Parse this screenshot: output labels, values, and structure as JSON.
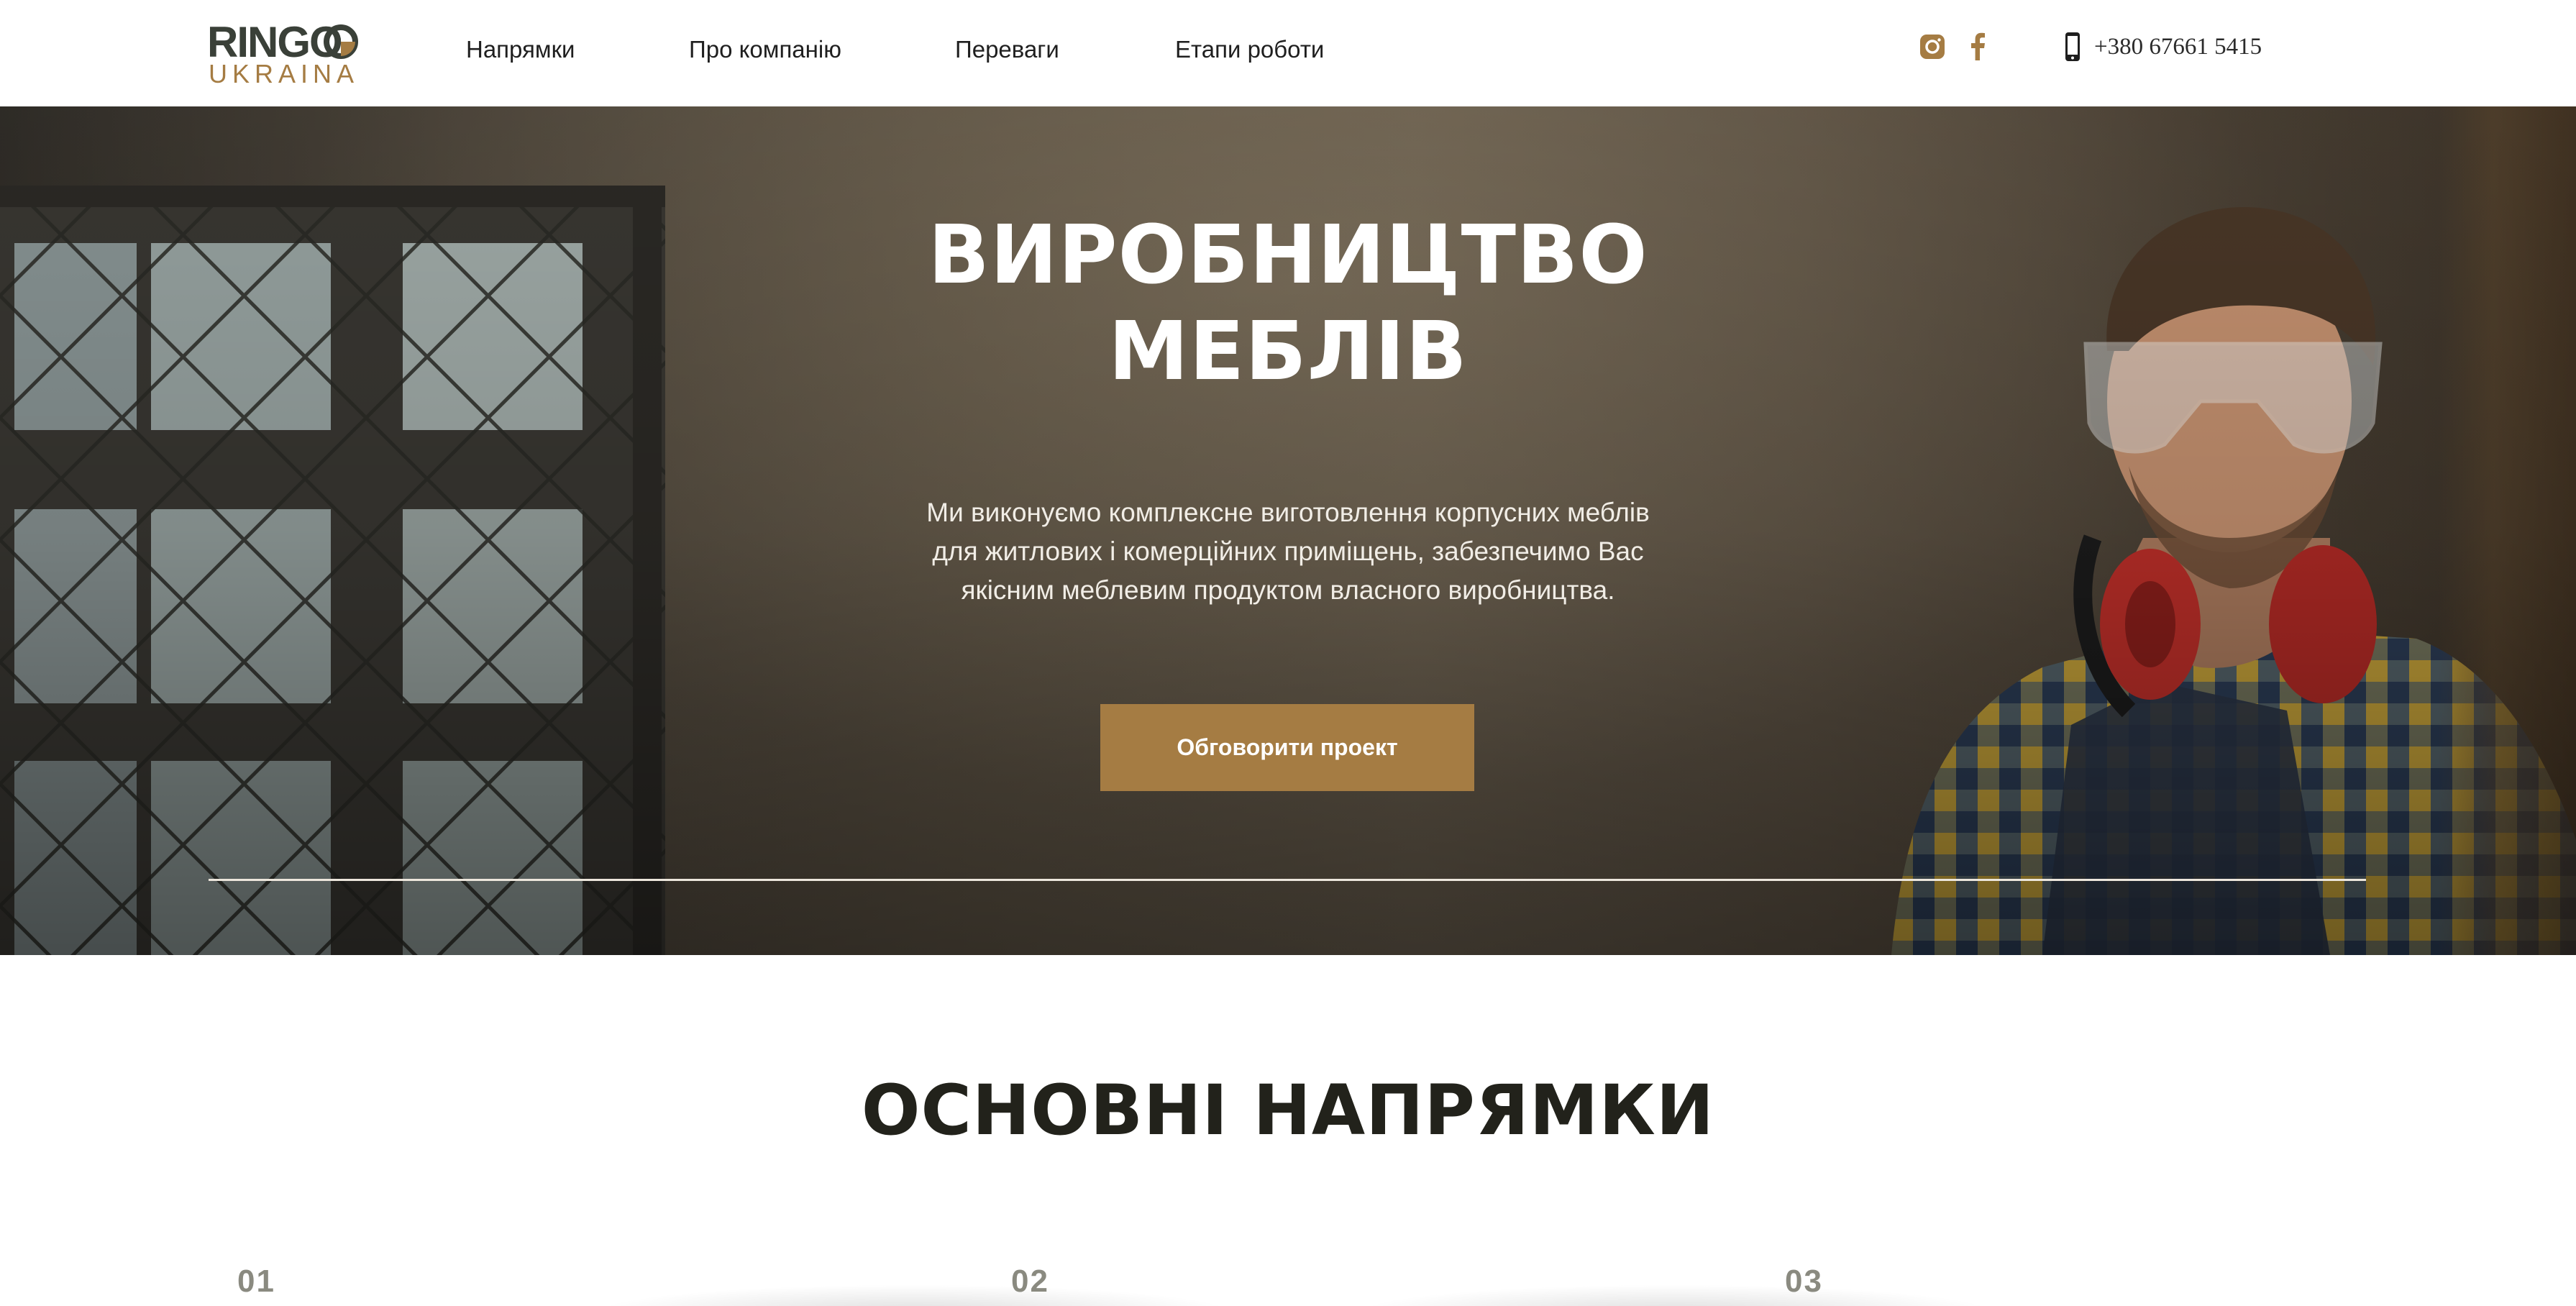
{
  "brand": {
    "logo_main": "RINGO",
    "logo_sub": "UKRAINA",
    "accent_color": "#a57c43",
    "dark_color": "#3a4038"
  },
  "nav": {
    "items": [
      {
        "label": "Напрямки"
      },
      {
        "label": "Про компанію"
      },
      {
        "label": "Переваги"
      },
      {
        "label": "Етапи роботи"
      }
    ]
  },
  "social": {
    "icons": [
      "instagram-icon",
      "facebook-icon"
    ]
  },
  "contact": {
    "phone_icon": "phone-icon",
    "phone": "+380 67661 5415"
  },
  "hero": {
    "title_line1": "ВИРОБНИЦТВО",
    "title_line2": "МЕБЛІВ",
    "desc_line1": "Ми виконуємо комплексне виготовлення корпусних меблів",
    "desc_line2": "для житлових і комерційних приміщень, забезпечимо Вас",
    "desc_line3": "якісним меблевим продуктом власного виробництва.",
    "cta_label": "Обговорити проект"
  },
  "directions": {
    "title": "ОСНОВНІ НАПРЯМКИ",
    "cards": [
      {
        "number": "01"
      },
      {
        "number": "02"
      },
      {
        "number": "03"
      }
    ]
  }
}
